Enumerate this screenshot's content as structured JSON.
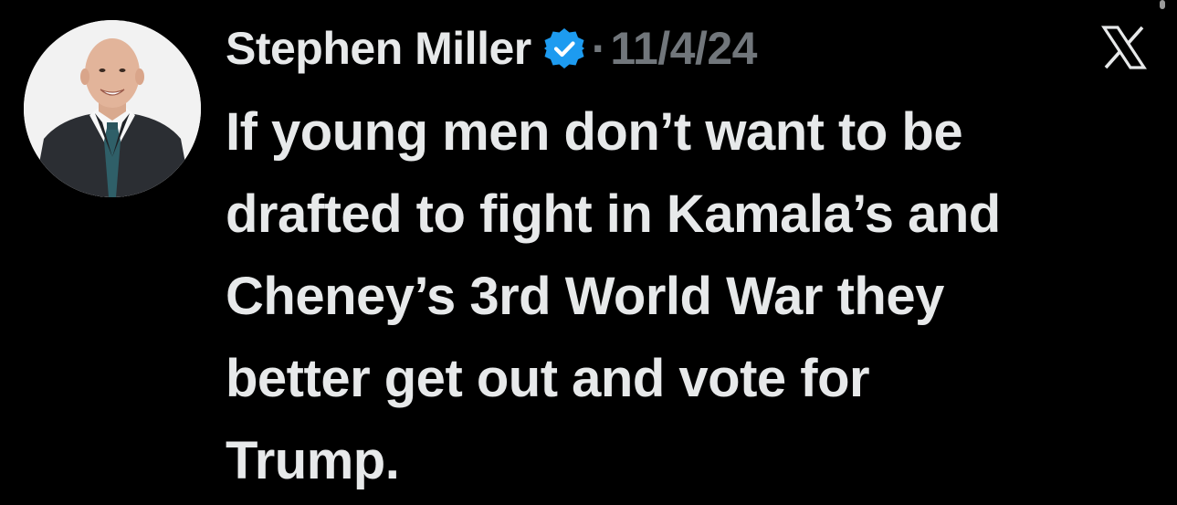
{
  "post": {
    "author_name": "Stephen Miller",
    "verified": true,
    "separator": "·",
    "date": "11/4/24",
    "text": "If young men don’t want to be\ndrafted to fight in Kamala’s and\nCheney’s 3rd World War they\nbetter get out and vote for\nTrump."
  },
  "icons": {
    "avatar": "profile-photo",
    "badge": "verified-check-icon",
    "brand": "x-logo-icon"
  },
  "colors": {
    "background": "#000000",
    "text_primary": "#e7e9ea",
    "text_secondary": "#71767b",
    "verified_blue": "#1d9bf0"
  }
}
